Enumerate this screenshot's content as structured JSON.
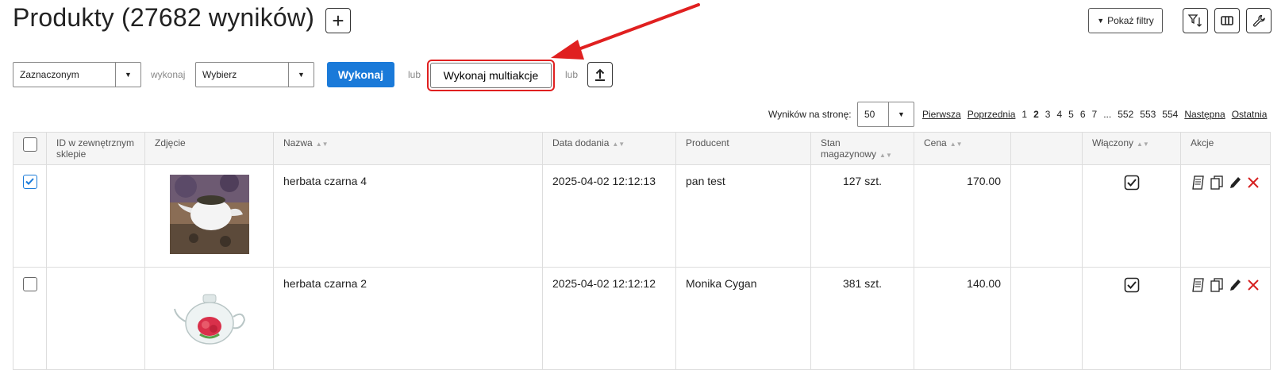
{
  "header": {
    "title": "Produkty (27682 wyników)",
    "add_label": "+",
    "filters_label": "Pokaż filtry"
  },
  "bulk": {
    "scope_select": "Zaznaczonym",
    "run_word": "wykonaj",
    "action_select": "Wybierz",
    "run_label": "Wykonaj",
    "or_1": "lub",
    "multi_label": "Wykonaj multiakcje",
    "or_2": "lub"
  },
  "pagination": {
    "per_page_label": "Wyników na stronę:",
    "per_page_value": "50",
    "first": "Pierwsza",
    "prev": "Poprzednia",
    "pages": [
      "1",
      "2",
      "3",
      "4",
      "5",
      "6",
      "7",
      "...",
      "552",
      "553",
      "554"
    ],
    "current": "2",
    "next": "Następna",
    "last": "Ostatnia"
  },
  "table": {
    "columns": {
      "external_id": "ID w zewnętrznym sklepie",
      "photo": "Zdjęcie",
      "name": "Nazwa",
      "date": "Data dodania",
      "producer": "Producent",
      "stock": "Stan magazynowy",
      "price": "Cena",
      "blank": "",
      "enabled": "Włączony",
      "actions": "Akcje"
    },
    "rows": [
      {
        "checked": true,
        "external_id": "",
        "name": "herbata czarna 4",
        "date": "2025-04-02 12:12:13",
        "producer": "pan test",
        "stock": "127 szt.",
        "price": "170.00",
        "enabled": true
      },
      {
        "checked": false,
        "external_id": "",
        "name": "herbata czarna 2",
        "date": "2025-04-02 12:12:12",
        "producer": "Monika Cygan",
        "stock": "381 szt.",
        "price": "140.00",
        "enabled": true
      }
    ]
  },
  "colors": {
    "primary": "#1a7ad9",
    "highlight": "#e02020",
    "delete": "#d62020"
  }
}
